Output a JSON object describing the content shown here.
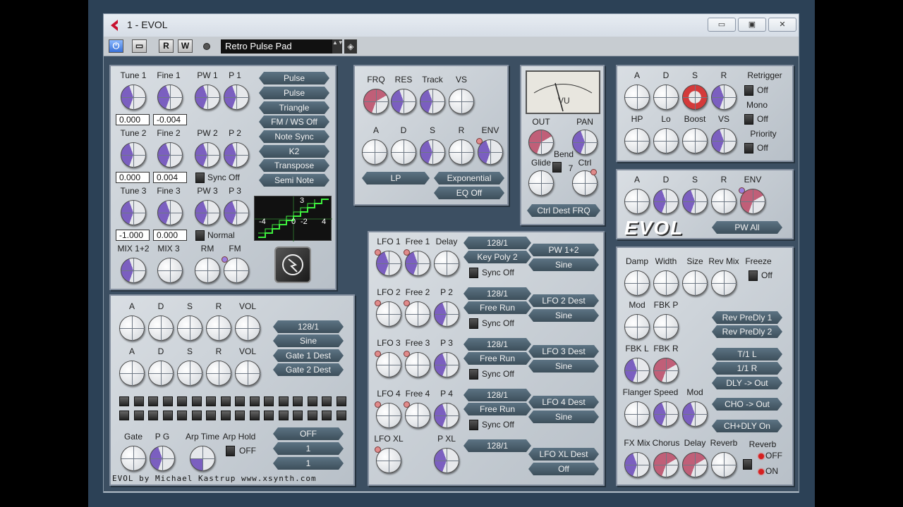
{
  "window": {
    "title": "1 - EVOL",
    "minimize": "▭",
    "maximize": "▣",
    "close": "✕"
  },
  "toolbar": {
    "power": "⏻",
    "bypass": "▭",
    "read": "R",
    "write": "W",
    "preset": "Retro Pulse Pad",
    "preset_arrows": "▲▼"
  },
  "osc": {
    "tune1": "Tune 1",
    "fine1": "Fine 1",
    "pw1": "PW 1",
    "p1": "P 1",
    "tune1_val": "0.000",
    "fine1_val": "-0.004",
    "tune2": "Tune 2",
    "fine2": "Fine 2",
    "pw2": "PW 2",
    "p2": "P 2",
    "tune2_val": "0.000",
    "fine2_val": "0.004",
    "sync_off": "Sync Off",
    "tune3": "Tune 3",
    "fine3": "Fine 3",
    "pw3": "PW 3",
    "p3": "P 3",
    "tune3_val": "-1.000",
    "fine3_val": "0.000",
    "normal": "Normal",
    "mix12": "MIX 1+2",
    "mix3": "MIX 3",
    "rm": "RM",
    "fm": "FM",
    "btns": [
      "Pulse",
      "Pulse",
      "Triangle",
      "FM / WS Off",
      "Note Sync",
      "K2",
      "Transpose",
      "Semi Note"
    ],
    "scope_labels": [
      "3",
      "-4",
      "0",
      "-2",
      "4"
    ]
  },
  "filter": {
    "frq": "FRQ",
    "res": "RES",
    "track": "Track",
    "vs": "VS",
    "a": "A",
    "d": "D",
    "s": "S",
    "r": "R",
    "env": "ENV",
    "lp": "LP",
    "exponential": "Exponential",
    "eq_off": "EQ Off"
  },
  "vu": {
    "vu": "VU",
    "out": "OUT",
    "pan": "PAN",
    "glide": "Glide",
    "bend": "Bend",
    "bend_val": "7",
    "ctrl": "Ctrl",
    "ctrl_dest": "Ctrl Dest FRQ"
  },
  "amp": {
    "a": "A",
    "d": "D",
    "s": "S",
    "r": "R",
    "retrigger": "Retrigger",
    "off1": "Off",
    "mono": "Mono",
    "off2": "Off",
    "hp": "HP",
    "lo": "Lo",
    "boost": "Boost",
    "vs": "VS",
    "priority": "Priority",
    "off3": "Off"
  },
  "env2": {
    "a": "A",
    "d": "D",
    "s": "S",
    "r": "R",
    "env": "ENV",
    "logo": "EVOL",
    "pw_all": "PW All"
  },
  "gate": {
    "a1": "A",
    "d1": "D",
    "s1": "S",
    "r1": "R",
    "vol1": "VOL",
    "a2": "A",
    "d2": "D",
    "s2": "S",
    "r2": "R",
    "vol2": "VOL",
    "btns": [
      "128/1",
      "Sine",
      "Gate 1 Dest",
      "Gate 2 Dest"
    ],
    "gate": "Gate",
    "pg": "P G",
    "arp_time": "Arp Time",
    "arp_hold": "Arp Hold",
    "arp_off": "OFF",
    "arp_btns": [
      "OFF",
      "1",
      "1"
    ],
    "credit": "EVOL by Michael Kastrup www.xsynth.com"
  },
  "lfo": {
    "rows": [
      {
        "l1": "LFO 1",
        "l2": "Free 1",
        "l3": "Delay",
        "b1": "128/1",
        "b2": "Key Poly 2",
        "sync": "Sync Off",
        "d1": "PW 1+2",
        "d2": "Sine"
      },
      {
        "l1": "LFO 2",
        "l2": "Free 2",
        "l3": "P 2",
        "b1": "128/1",
        "b2": "Free Run",
        "sync": "Sync Off",
        "d1": "LFO 2 Dest",
        "d2": "Sine"
      },
      {
        "l1": "LFO 3",
        "l2": "Free 3",
        "l3": "P 3",
        "b1": "128/1",
        "b2": "Free Run",
        "sync": "Sync Off",
        "d1": "LFO 3 Dest",
        "d2": "Sine"
      },
      {
        "l1": "LFO 4",
        "l2": "Free 4",
        "l3": "P 4",
        "b1": "128/1",
        "b2": "Free Run",
        "sync": "Sync Off",
        "d1": "LFO 4 Dest",
        "d2": "Sine"
      }
    ],
    "xl": "LFO XL",
    "pxl": "P XL",
    "xl_b1": "128/1",
    "xl_d1": "LFO XL Dest",
    "xl_d2": "Off"
  },
  "fx": {
    "damp": "Damp",
    "width": "Width",
    "size": "Size",
    "revmix": "Rev Mix",
    "freeze": "Freeze",
    "freeze_off": "Off",
    "mod": "Mod",
    "fbkp": "FBK P",
    "fbkl": "FBK L",
    "fbkr": "FBK R",
    "flanger": "Flanger",
    "speed": "Speed",
    "mod2": "Mod",
    "fxmix": "FX Mix",
    "chorus": "Chorus",
    "delay": "Delay",
    "reverb": "Reverb",
    "reverb2": "Reverb",
    "off": "OFF",
    "on": "ON",
    "btns": [
      "Rev PreDly 1",
      "Rev PreDly 2",
      "T/1 L",
      "1/1 R",
      "DLY -> Out",
      "CHO -> Out",
      "CH+DLY On"
    ]
  }
}
